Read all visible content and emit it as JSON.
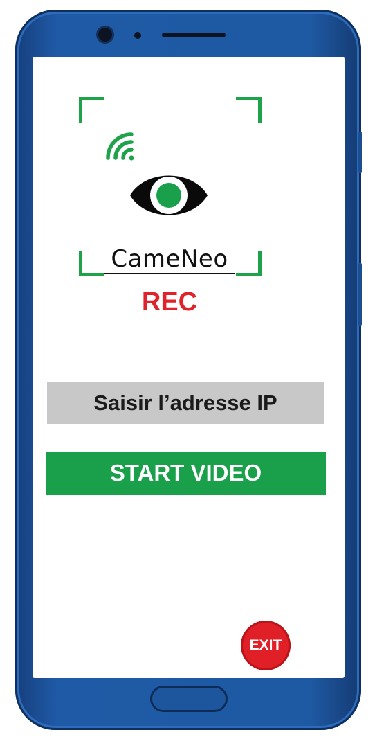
{
  "app": {
    "brand_name": "CameNeo",
    "status_label": "REC"
  },
  "ip_input": {
    "placeholder": "Saisir l’adresse IP",
    "value": ""
  },
  "start_button": {
    "label": "START VIDEO"
  },
  "exit_button": {
    "label": "EXIT"
  },
  "colors": {
    "accent_green": "#1aa04a",
    "rec_red": "#e0232b",
    "exit_red": "#e02026",
    "input_gray": "#c8c8c8",
    "phone_blue": "#1f5aa6"
  },
  "icons": [
    "wifi-icon",
    "eye-icon"
  ]
}
